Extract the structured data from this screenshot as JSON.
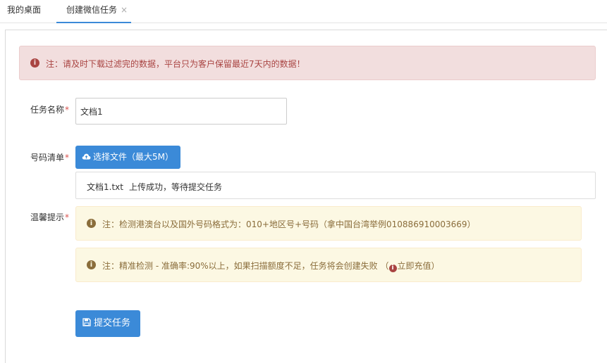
{
  "tabs": [
    {
      "label": "我的桌面"
    },
    {
      "label": "创建微信任务",
      "close": "×"
    }
  ],
  "alert_danger": {
    "icon": "info-circle-icon",
    "text": "注：请及时下载过滤完的数据，平台只为客户保留最近7天内的数据！"
  },
  "form": {
    "task_name_label": "任务名称",
    "number_list_label": "号码清单",
    "tips_label": "温馨提示",
    "required_mark": "*",
    "task_name_value": "文档1",
    "upload_button_label": "选择文件（最大5M）",
    "upload_file_name": "文档1.txt",
    "upload_status": "上传成功，等待提交任务",
    "submit_button_label": "提交任务"
  },
  "tips": {
    "tip1": "注：检测港澳台以及国外号码格式为：010+地区号+号码（拿中国台湾举例010886910003669）",
    "tip2_prefix": "注：精准检测 - 准确率:90%以上，如果扫描额度不足，任务将会创建失败 （",
    "tip2_link": "立即充值",
    "tip2_suffix": "）"
  },
  "colors": {
    "primary": "#3b8ad8",
    "danger_bg": "#f2dede",
    "danger_text": "#a94442",
    "warning_bg": "#fcf8e3",
    "warning_text": "#8a6d3b",
    "required": "#d9534f"
  }
}
